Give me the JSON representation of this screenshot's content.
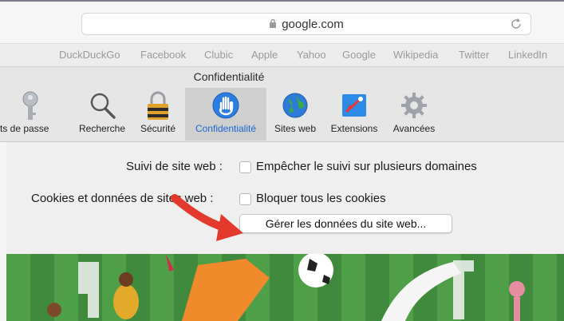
{
  "address_bar": {
    "url": "google.com"
  },
  "favorites": [
    "DuckDuckGo",
    "Facebook",
    "Clubic",
    "Apple",
    "Yahoo",
    "Google",
    "Wikipedia",
    "Twitter",
    "LinkedIn"
  ],
  "preferences": {
    "title": "Confidentialité",
    "tabs": [
      {
        "label": "ts de passe",
        "icon": "key-icon"
      },
      {
        "label": "Recherche",
        "icon": "magnifier-icon"
      },
      {
        "label": "Sécurité",
        "icon": "padlock-icon"
      },
      {
        "label": "Confidentialité",
        "icon": "hand-icon",
        "selected": true
      },
      {
        "label": "Sites web",
        "icon": "globe-icon"
      },
      {
        "label": "Extensions",
        "icon": "puzzle-icon"
      },
      {
        "label": "Avancées",
        "icon": "gear-icon"
      }
    ],
    "tracking": {
      "label": "Suivi de site web :",
      "checkbox_label": "Empêcher le suivi sur plusieurs domaines",
      "checked": false
    },
    "cookies": {
      "label": "Cookies et données de sites web :",
      "checkbox_label": "Bloquer tous les cookies",
      "checked": false
    },
    "manage_button": "Gérer les données du site web..."
  },
  "colors": {
    "accent": "#1868d1",
    "arrow": "#e43a2e"
  }
}
